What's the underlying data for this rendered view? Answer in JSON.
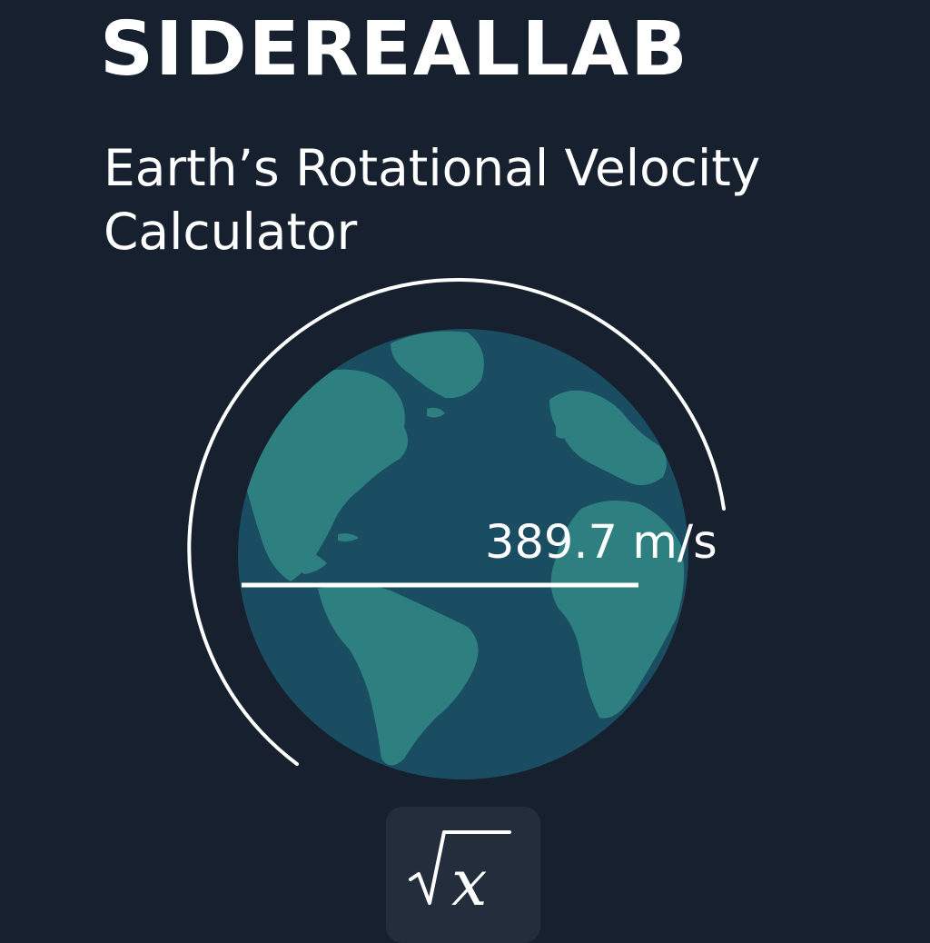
{
  "header": {
    "brand": "SIDEREALLAB",
    "subtitle": "Earth’s Rotational Velocity Calculator"
  },
  "result": {
    "speed_label": "389.7 m/s"
  },
  "formula_button": {
    "icon": "square-root-x-icon",
    "variable": "x"
  },
  "colors": {
    "background": "#17202e",
    "ocean": "#1a4d62",
    "land": "#2e8080",
    "arc": "#ffffff",
    "button": "#232d3b"
  }
}
